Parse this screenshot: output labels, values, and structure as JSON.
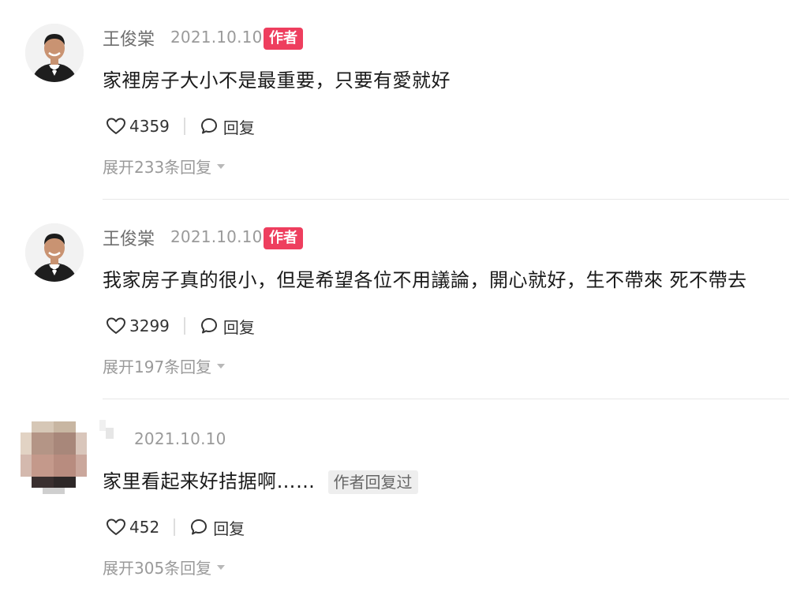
{
  "comments": [
    {
      "user": "王俊棠",
      "date": "2021.10.10",
      "badge": "作者",
      "text": "家裡房子大小不是最重要，只要有愛就好",
      "likes": "4359",
      "reply_label": "回复",
      "expand_label": "展开233条回复"
    },
    {
      "user": "王俊棠",
      "date": "2021.10.10",
      "badge": "作者",
      "text": "我家房子真的很小，但是希望各位不用議論，開心就好，生不帶來 死不帶去",
      "likes": "3299",
      "reply_label": "回复",
      "expand_label": "展开197条回复"
    },
    {
      "date": "2021.10.10",
      "text": "家里看起来好拮据啊……",
      "tag": "作者回复过",
      "likes": "452",
      "reply_label": "回复",
      "expand_label": "展开305条回复"
    }
  ],
  "colors": {
    "badge": "#ee3e5e",
    "meta": "#9a9a9a",
    "text": "#1a1a1a"
  },
  "icons": [
    "heart-icon",
    "comment-bubble-icon",
    "caret-down-icon"
  ]
}
